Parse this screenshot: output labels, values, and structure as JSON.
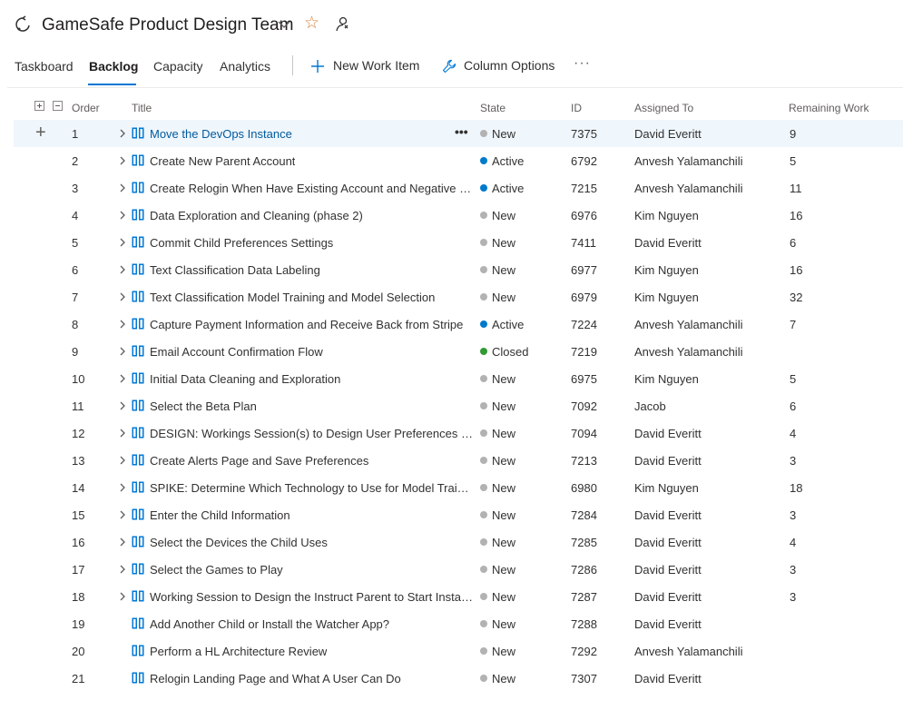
{
  "header": {
    "team_name": "GameSafe Product Design Team",
    "icons": [
      "team-icon",
      "chevron-down-icon",
      "star-icon",
      "people-settings-icon"
    ],
    "favorite_color": "#d67f3c"
  },
  "tabs": [
    {
      "label": "Taskboard",
      "active": false
    },
    {
      "label": "Backlog",
      "active": true
    },
    {
      "label": "Capacity",
      "active": false
    },
    {
      "label": "Analytics",
      "active": false
    }
  ],
  "toolbar": {
    "new_work_item": "New Work Item",
    "column_options": "Column Options",
    "more": "···"
  },
  "columns": {
    "order": "Order",
    "title": "Title",
    "state": "State",
    "id": "ID",
    "assigned_to": "Assigned To",
    "remaining_work": "Remaining Work"
  },
  "state_colors": {
    "New": "#b2b2b2",
    "Active": "#007acc",
    "Closed": "#339933"
  },
  "accent_color": "#0078d4",
  "work_item_icon_color": "#0078d4",
  "rows": [
    {
      "order": "1",
      "title": "Move the DevOps Instance",
      "state": "New",
      "id": "7375",
      "assigned_to": "David Everitt",
      "remaining": "9",
      "expandable": true,
      "selected": true
    },
    {
      "order": "2",
      "title": "Create New Parent Account",
      "state": "Active",
      "id": "6792",
      "assigned_to": "Anvesh Yalamanchili",
      "remaining": "5",
      "expandable": true
    },
    {
      "order": "3",
      "title": "Create Relogin When Have Existing Account and Negative U...",
      "state": "Active",
      "id": "7215",
      "assigned_to": "Anvesh Yalamanchili",
      "remaining": "11",
      "expandable": true
    },
    {
      "order": "4",
      "title": "Data Exploration and Cleaning (phase 2)",
      "state": "New",
      "id": "6976",
      "assigned_to": "Kim Nguyen",
      "remaining": "16",
      "expandable": true
    },
    {
      "order": "5",
      "title": "Commit Child Preferences Settings",
      "state": "New",
      "id": "7411",
      "assigned_to": "David Everitt",
      "remaining": "6",
      "expandable": true
    },
    {
      "order": "6",
      "title": "Text Classification Data Labeling",
      "state": "New",
      "id": "6977",
      "assigned_to": "Kim Nguyen",
      "remaining": "16",
      "expandable": true
    },
    {
      "order": "7",
      "title": "Text Classification Model Training and Model Selection",
      "state": "New",
      "id": "6979",
      "assigned_to": "Kim Nguyen",
      "remaining": "32",
      "expandable": true
    },
    {
      "order": "8",
      "title": "Capture Payment Information and Receive Back from Stripe",
      "state": "Active",
      "id": "7224",
      "assigned_to": "Anvesh Yalamanchili",
      "remaining": "7",
      "expandable": true
    },
    {
      "order": "9",
      "title": "Email Account Confirmation Flow",
      "state": "Closed",
      "id": "7219",
      "assigned_to": "Anvesh Yalamanchili",
      "remaining": "",
      "expandable": true
    },
    {
      "order": "10",
      "title": "Initial Data Cleaning and Exploration",
      "state": "New",
      "id": "6975",
      "assigned_to": "Kim Nguyen",
      "remaining": "5",
      "expandable": true
    },
    {
      "order": "11",
      "title": "Select the Beta Plan",
      "state": "New",
      "id": "7092",
      "assigned_to": "Jacob",
      "remaining": "6",
      "expandable": true
    },
    {
      "order": "12",
      "title": "DESIGN: Workings Session(s) to Design User Preferences Sc...",
      "state": "New",
      "id": "7094",
      "assigned_to": "David Everitt",
      "remaining": "4",
      "expandable": true
    },
    {
      "order": "13",
      "title": "Create Alerts Page and Save Preferences",
      "state": "New",
      "id": "7213",
      "assigned_to": "David Everitt",
      "remaining": "3",
      "expandable": true
    },
    {
      "order": "14",
      "title": "SPIKE: Determine Which Technology to Use for Model Traini...",
      "state": "New",
      "id": "6980",
      "assigned_to": "Kim Nguyen",
      "remaining": "18",
      "expandable": true
    },
    {
      "order": "15",
      "title": "Enter the Child Information",
      "state": "New",
      "id": "7284",
      "assigned_to": "David Everitt",
      "remaining": "3",
      "expandable": true
    },
    {
      "order": "16",
      "title": "Select the Devices the Child Uses",
      "state": "New",
      "id": "7285",
      "assigned_to": "David Everitt",
      "remaining": "4",
      "expandable": true
    },
    {
      "order": "17",
      "title": "Select the Games to Play",
      "state": "New",
      "id": "7286",
      "assigned_to": "David Everitt",
      "remaining": "3",
      "expandable": true
    },
    {
      "order": "18",
      "title": "Working Session to Design the Instruct Parent to Start Install...",
      "state": "New",
      "id": "7287",
      "assigned_to": "David Everitt",
      "remaining": "3",
      "expandable": true
    },
    {
      "order": "19",
      "title": "Add Another Child or Install the Watcher App?",
      "state": "New",
      "id": "7288",
      "assigned_to": "David Everitt",
      "remaining": "",
      "expandable": false
    },
    {
      "order": "20",
      "title": "Perform a HL Architecture Review",
      "state": "New",
      "id": "7292",
      "assigned_to": "Anvesh Yalamanchili",
      "remaining": "",
      "expandable": false
    },
    {
      "order": "21",
      "title": "Relogin Landing Page and What A User Can Do",
      "state": "New",
      "id": "7307",
      "assigned_to": "David Everitt",
      "remaining": "",
      "expandable": false
    }
  ]
}
